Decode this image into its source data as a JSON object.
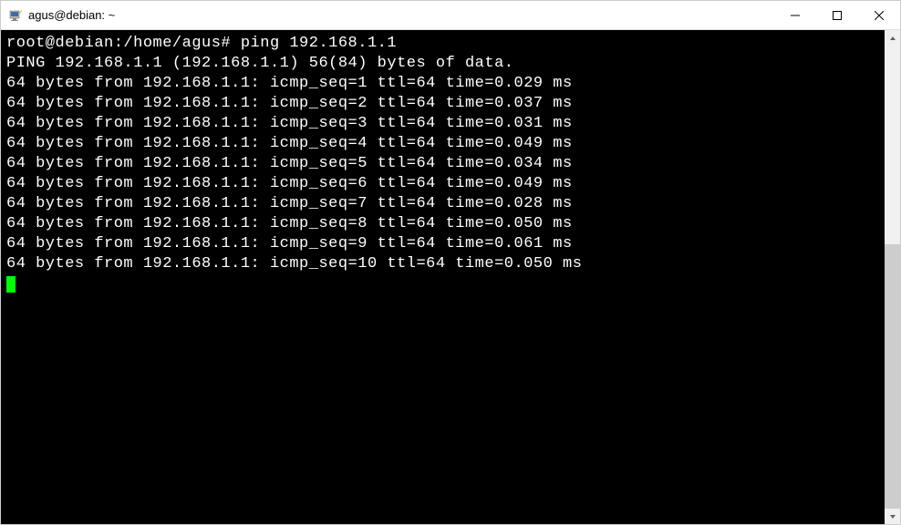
{
  "window": {
    "title": "agus@debian: ~"
  },
  "terminal": {
    "prompt_user_host": "root@debian",
    "prompt_path": ":/home/agus#",
    "command": "ping 192.168.1.1",
    "ping_header": "PING 192.168.1.1 (192.168.1.1) 56(84) bytes of data.",
    "replies": [
      "64 bytes from 192.168.1.1: icmp_seq=1 ttl=64 time=0.029 ms",
      "64 bytes from 192.168.1.1: icmp_seq=2 ttl=64 time=0.037 ms",
      "64 bytes from 192.168.1.1: icmp_seq=3 ttl=64 time=0.031 ms",
      "64 bytes from 192.168.1.1: icmp_seq=4 ttl=64 time=0.049 ms",
      "64 bytes from 192.168.1.1: icmp_seq=5 ttl=64 time=0.034 ms",
      "64 bytes from 192.168.1.1: icmp_seq=6 ttl=64 time=0.049 ms",
      "64 bytes from 192.168.1.1: icmp_seq=7 ttl=64 time=0.028 ms",
      "64 bytes from 192.168.1.1: icmp_seq=8 ttl=64 time=0.050 ms",
      "64 bytes from 192.168.1.1: icmp_seq=9 ttl=64 time=0.061 ms",
      "64 bytes from 192.168.1.1: icmp_seq=10 ttl=64 time=0.050 ms"
    ]
  }
}
